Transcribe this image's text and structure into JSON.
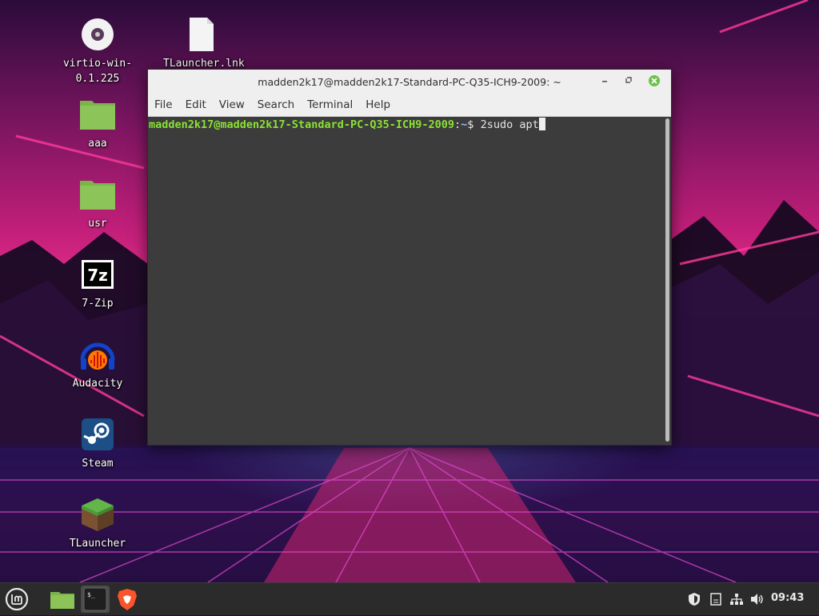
{
  "desktop": {
    "icons": [
      {
        "label": "virtio-win-\n0.1.225",
        "icon": "disc-icon"
      },
      {
        "label": "TLauncher.lnk",
        "icon": "file-icon"
      },
      {
        "label": "aaa",
        "icon": "folder-icon"
      },
      {
        "label": "usr",
        "icon": "folder-icon"
      },
      {
        "label": "7-Zip",
        "icon": "7zip-icon"
      },
      {
        "label": "Audacity",
        "icon": "audacity-icon"
      },
      {
        "label": "Steam",
        "icon": "steam-icon"
      },
      {
        "label": "TLauncher",
        "icon": "minecraft-grass-block-icon"
      }
    ]
  },
  "window": {
    "title": "madden2k17@madden2k17-Standard-PC-Q35-ICH9-2009: ~",
    "menu": [
      "File",
      "Edit",
      "View",
      "Search",
      "Terminal",
      "Help"
    ],
    "terminal": {
      "prompt_user": "madden2k17@madden2k17-Standard-PC-Q35-ICH9-2009",
      "prompt_sep": ":",
      "prompt_dir": "~",
      "prompt_end": "$ ",
      "command": "2sudo apt"
    }
  },
  "taskbar": {
    "apps": [
      "mint-menu-icon",
      "files-folder-icon",
      "terminal-icon",
      "brave-browser-icon"
    ],
    "tray_icons": [
      "shield-icon",
      "notes-icon",
      "network-icon",
      "volume-icon"
    ],
    "clock": "09:43"
  },
  "colors": {
    "accent_green": "#8ae234",
    "close_green": "#6cc24a",
    "folder_green": "#79b549"
  }
}
